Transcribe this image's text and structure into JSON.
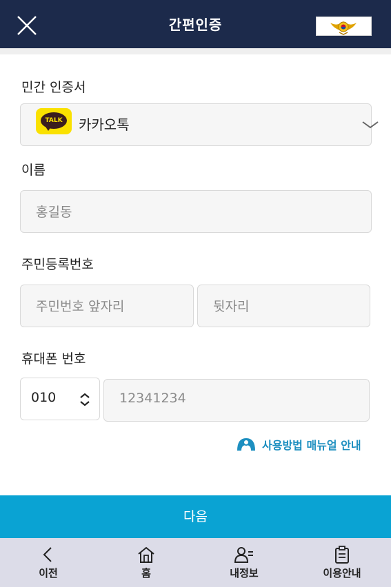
{
  "header": {
    "title": "간편인증",
    "close_icon": "close-icon",
    "emblem_icon": "police-emblem-icon"
  },
  "certificate": {
    "label": "민간 인증서",
    "selected": "카카오톡",
    "kakao_badge": "TALK",
    "dropdown_icon": "chevron-down-icon"
  },
  "name": {
    "label": "이름",
    "placeholder": "홍길동"
  },
  "rrn": {
    "label": "주민등록번호",
    "front_placeholder": "주민번호 앞자리",
    "back_placeholder": "뒷자리"
  },
  "phone": {
    "label": "휴대폰 번호",
    "carrier_value": "010",
    "number_placeholder": "12341234"
  },
  "manual_link": {
    "label": "사용방법 매뉴얼 안내",
    "icon": "user-guide-icon"
  },
  "next_button": {
    "label": "다음"
  },
  "tabbar": {
    "items": [
      {
        "label": "이전",
        "icon": "back-arrow-icon"
      },
      {
        "label": "홈",
        "icon": "home-icon"
      },
      {
        "label": "내정보",
        "icon": "my-info-icon"
      },
      {
        "label": "이용안내",
        "icon": "guide-clipboard-icon"
      }
    ]
  },
  "colors": {
    "header_bg": "#1c2a4b",
    "accent": "#0aa3d3",
    "link": "#1d8fc0",
    "kakao_yellow": "#fae100",
    "tabbar_bg": "#dcdce8"
  }
}
